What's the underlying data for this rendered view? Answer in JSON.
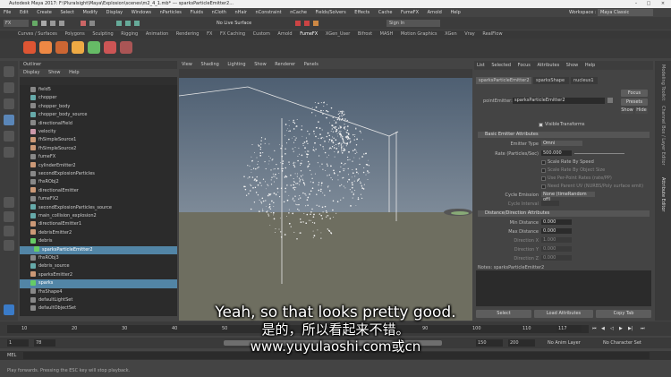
{
  "window": {
    "title": "Autodesk Maya 2017: F:\\Pluralsight\\Maya\\Explosion\\scenes\\m2_4_1.mb* --- sparksParticleEmitter2..."
  },
  "menus": [
    "File",
    "Edit",
    "Create",
    "Select",
    "Modify",
    "Display",
    "Windows",
    "nParticles",
    "Fluids",
    "nCloth",
    "nHair",
    "nConstraint",
    "nCache",
    "Fields/Solvers",
    "Effects",
    "Cache",
    "FumeFX",
    "Arnold",
    "Help"
  ],
  "workspace": {
    "label": "Workspace :",
    "value": "Maya Classic"
  },
  "statusline": {
    "mode": "FX",
    "live_surface": "No Live Surface",
    "sign_in": "Sign In"
  },
  "shelf_tabs": [
    "Curves / Surfaces",
    "Polygons",
    "Sculpting",
    "Rigging",
    "Animation",
    "Rendering",
    "FX",
    "FX Caching",
    "Custom",
    "Arnold",
    "FumeFX",
    "XGen_User",
    "Bifrost",
    "MASH",
    "Motion Graphics",
    "XGen",
    "Vray",
    "RealFlow"
  ],
  "outliner": {
    "title": "Outliner",
    "menu": [
      "Display",
      "Show",
      "Help"
    ],
    "items": [
      {
        "label": "field5",
        "color": "#888"
      },
      {
        "label": "chopper",
        "color": "#6aa"
      },
      {
        "label": "chopper_body",
        "color": "#888"
      },
      {
        "label": "chopper_body_source",
        "color": "#6aa"
      },
      {
        "label": "directionalField",
        "color": "#888"
      },
      {
        "label": "velocity",
        "color": "#c9a"
      },
      {
        "label": "fhSimpleSource1",
        "color": "#c97"
      },
      {
        "label": "fhSimpleSource2",
        "color": "#c97"
      },
      {
        "label": "fumeFX",
        "color": "#888"
      },
      {
        "label": "cylinderEmitter2",
        "color": "#c97"
      },
      {
        "label": "secondExplosionParticles",
        "color": "#888"
      },
      {
        "label": "fhsRObj2",
        "color": "#888"
      },
      {
        "label": "directionalEmitter",
        "color": "#c97"
      },
      {
        "label": "fumeFX2",
        "color": "#888"
      },
      {
        "label": "secondExplosionParticles_source",
        "color": "#6aa"
      },
      {
        "label": "main_collision_explosion2",
        "color": "#6aa"
      },
      {
        "label": "directionalEmitter1",
        "color": "#c97"
      },
      {
        "label": "debrisEmitter2",
        "color": "#c97"
      },
      {
        "label": "debris",
        "color": "#6c6"
      },
      {
        "label": "sparksParticleEmitter2",
        "color": "#6c6",
        "selected": true
      },
      {
        "label": "fhsRObj3",
        "color": "#888"
      },
      {
        "label": "debris_source",
        "color": "#6aa"
      },
      {
        "label": "sparksEmitter2",
        "color": "#c97"
      },
      {
        "label": "sparks",
        "color": "#6c6",
        "selected": true
      },
      {
        "label": "fhsShape4",
        "color": "#888"
      },
      {
        "label": "defaultLightSet",
        "color": "#888"
      },
      {
        "label": "defaultObjectSet",
        "color": "#888"
      }
    ]
  },
  "viewport": {
    "menu": [
      "View",
      "Shading",
      "Lighting",
      "Show",
      "Renderer",
      "Panels"
    ]
  },
  "attribute_editor": {
    "tabs": [
      "List",
      "Selected",
      "Focus",
      "Attributes",
      "Show",
      "Help"
    ],
    "node_tabs": [
      "sparksParticleEmitter2",
      "sparksShape",
      "nucleus1"
    ],
    "pointEmitter_label": "pointEmitter:",
    "pointEmitter_value": "sparksParticleEmitter2",
    "focus_btn": "Focus",
    "presets_btn": "Presets",
    "show_btn": "Show",
    "hide_btn": "Hide",
    "visibility_label": "Visible",
    "visibility_value": "Transforms",
    "section_basic": "Basic Emitter Attributes",
    "emitter_type_label": "Emitter Type",
    "emitter_type_value": "Omni",
    "rate_label": "Rate (Particles/Sec)",
    "rate_value": "500.000",
    "scale_rate_speed": "Scale Rate By Speed",
    "scale_rate_size": "Scale Rate By Object Size",
    "need_parent_uv": "Use Per-Point Rates (rate/PP)",
    "need_parent_uv2": "Need Parent UV (NURBS/Poly surface emit)",
    "cycle_emission_label": "Cycle Emission",
    "cycle_emission_value": "None (timeRandom off)",
    "cycle_interval_label": "Cycle Interval",
    "section_distance": "Distance/Direction Attributes",
    "min_distance_label": "Min Distance",
    "min_distance_value": "0.000",
    "max_distance_label": "Max Distance",
    "max_distance_value": "0.000",
    "direction_x_label": "Direction X",
    "direction_x_value": "1.000",
    "direction_y_label": "Direction Y",
    "direction_y_value": "0.000",
    "direction_z_label": "Direction Z",
    "direction_z_value": "0.000",
    "notes_label": "Notes:  sparksParticleEmitter2",
    "select_btn": "Select",
    "load_attrs_btn": "Load Attributes",
    "copy_tab_btn": "Copy Tab"
  },
  "side_strip": [
    "Modeling Toolkit",
    "Channel Box / Layer Editor",
    "Attribute Editor"
  ],
  "timeline": {
    "ticks": [
      "10",
      "20",
      "30",
      "40",
      "50",
      "60",
      "70",
      "80",
      "90",
      "100",
      "110"
    ],
    "current_frame": "117",
    "start": "1",
    "start2": "78",
    "end1": "150",
    "end2": "200",
    "anim_layer": "No Anim Layer",
    "char_set": "No Character Set"
  },
  "cmdline": {
    "label": "MEL"
  },
  "helpline": {
    "text": "Play forwards. Pressing the ESC key will stop playback."
  },
  "subtitles": {
    "line1": "Yeah, so that looks pretty good.",
    "line2": "是的，所以看起来不错。",
    "line3": "www.yuyulaoshi.com或cn"
  },
  "colors": {
    "selection": "#5285a6",
    "viewport_sky": "#5b6b7d",
    "viewport_ground": "#6e6e60"
  }
}
